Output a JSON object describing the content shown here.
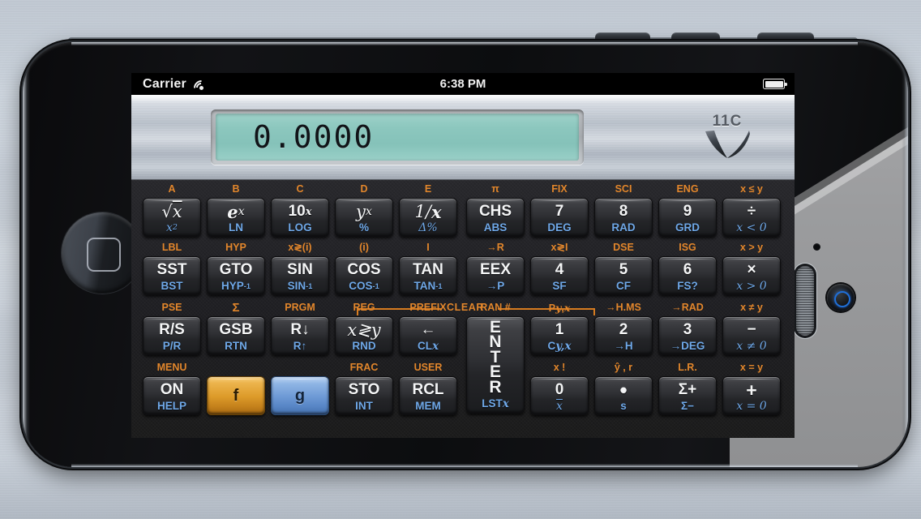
{
  "status_bar": {
    "carrier": "Carrier",
    "wifi_icon": "wifi-icon",
    "time": "6:38 PM",
    "battery_icon": "battery-icon"
  },
  "display": {
    "value": "0.0000",
    "lcd_color": "#8cc7be"
  },
  "brand": {
    "model": "11C",
    "mark": "hp-swoosh-logo"
  },
  "colors": {
    "f_shift": "#e2862b",
    "g_shift": "#6fa8e8",
    "key_face": "#2e2f33",
    "f_key": "#dd9b2a",
    "g_key": "#6e9ad6"
  },
  "clear_banner": {
    "label": "CLEAR"
  },
  "keys": {
    "row1": [
      {
        "f": "A",
        "main": "√<i>x</i>",
        "sub": "x²",
        "name": "key-sqrt"
      },
      {
        "f": "B",
        "main": "e<sup>x</sup>",
        "sub": "LN",
        "name": "key-exp"
      },
      {
        "f": "C",
        "main": "10<sup>x</sup>",
        "sub": "LOG",
        "name": "key-ten-pow-x"
      },
      {
        "f": "D",
        "main": "y<sup>x</sup>",
        "sub": "%",
        "name": "key-y-pow-x"
      },
      {
        "f": "E",
        "main": "1/x",
        "sub": "Δ%",
        "name": "key-reciprocal"
      },
      {
        "f": "π",
        "main": "CHS",
        "sub": "ABS",
        "name": "key-chs"
      },
      {
        "f": "FIX",
        "main": "7",
        "sub": "DEG",
        "name": "key-7"
      },
      {
        "f": "SCI",
        "main": "8",
        "sub": "RAD",
        "name": "key-8"
      },
      {
        "f": "ENG",
        "main": "9",
        "sub": "GRD",
        "name": "key-9"
      },
      {
        "f": "x ≤ y",
        "main": "÷",
        "sub": "x < 0",
        "name": "key-divide"
      }
    ],
    "row2": [
      {
        "f": "LBL",
        "main": "SST",
        "sub": "BST",
        "name": "key-sst"
      },
      {
        "f": "HYP",
        "main": "GTO",
        "sub": "HYP⁻¹",
        "name": "key-gto"
      },
      {
        "f": "x≷(i)",
        "main": "SIN",
        "sub": "SIN⁻¹",
        "name": "key-sin"
      },
      {
        "f": "(i)",
        "main": "COS",
        "sub": "COS⁻¹",
        "name": "key-cos"
      },
      {
        "f": "I",
        "main": "TAN",
        "sub": "TAN⁻¹",
        "name": "key-tan"
      },
      {
        "f": "→R",
        "main": "EEX",
        "sub": "→P",
        "name": "key-eex"
      },
      {
        "f": "x≷I",
        "main": "4",
        "sub": "SF",
        "name": "key-4"
      },
      {
        "f": "DSE",
        "main": "5",
        "sub": "CF",
        "name": "key-5"
      },
      {
        "f": "ISG",
        "main": "6",
        "sub": "FS?",
        "name": "key-6"
      },
      {
        "f": "x > y",
        "main": "×",
        "sub": "x > 0",
        "name": "key-multiply"
      }
    ],
    "row3": [
      {
        "f": "PSE",
        "main": "R/S",
        "sub": "P/R",
        "name": "key-rs"
      },
      {
        "f": "Σ",
        "main": "GSB",
        "sub": "RTN",
        "name": "key-gsb"
      },
      {
        "f": "PRGM",
        "main": "R↓",
        "sub": "R↑",
        "name": "key-roll-down"
      },
      {
        "f": "REG",
        "main": "x≷y",
        "sub": "RND",
        "name": "key-x-exchange-y"
      },
      {
        "f": "PREFIX",
        "main": "←",
        "sub": "CLx",
        "name": "key-backspace"
      },
      {
        "f": "RAN #",
        "main": "ENTER",
        "sub": "LSTx",
        "name": "key-enter"
      },
      {
        "f": "P y , x",
        "main": "1",
        "sub": "C y , x",
        "name": "key-1"
      },
      {
        "f": "→H.MS",
        "main": "2",
        "sub": "→H",
        "name": "key-2"
      },
      {
        "f": "→RAD",
        "main": "3",
        "sub": "→DEG",
        "name": "key-3"
      },
      {
        "f": "x ≠ y",
        "main": "−",
        "sub": "x ≠ 0",
        "name": "key-minus"
      }
    ],
    "row4": [
      {
        "f": "MENU",
        "main": "ON",
        "sub": "HELP",
        "name": "key-on"
      },
      {
        "f": "",
        "main": "f",
        "sub": "",
        "name": "key-f-shift"
      },
      {
        "f": "",
        "main": "g",
        "sub": "",
        "name": "key-g-shift"
      },
      {
        "f": "FRAC",
        "main": "STO",
        "sub": "INT",
        "name": "key-sto"
      },
      {
        "f": "USER",
        "main": "RCL",
        "sub": "MEM",
        "name": "key-rcl"
      },
      {
        "f": "x !",
        "main": "0",
        "sub": "x̅",
        "name": "key-0"
      },
      {
        "f": "ŷ , r",
        "main": "•",
        "sub": "s",
        "name": "key-decimal-point"
      },
      {
        "f": "L.R.",
        "main": "Σ+",
        "sub": "Σ−",
        "name": "key-sigma-plus"
      },
      {
        "f": "x = y",
        "main": "+",
        "sub": "x = 0",
        "name": "key-plus"
      }
    ]
  },
  "device": {
    "home_button": "home-button",
    "camera": "camera-lens",
    "speaker": "speaker-grille",
    "edge_buttons": [
      "volume-up-button",
      "volume-down-button",
      "mute-switch"
    ]
  }
}
